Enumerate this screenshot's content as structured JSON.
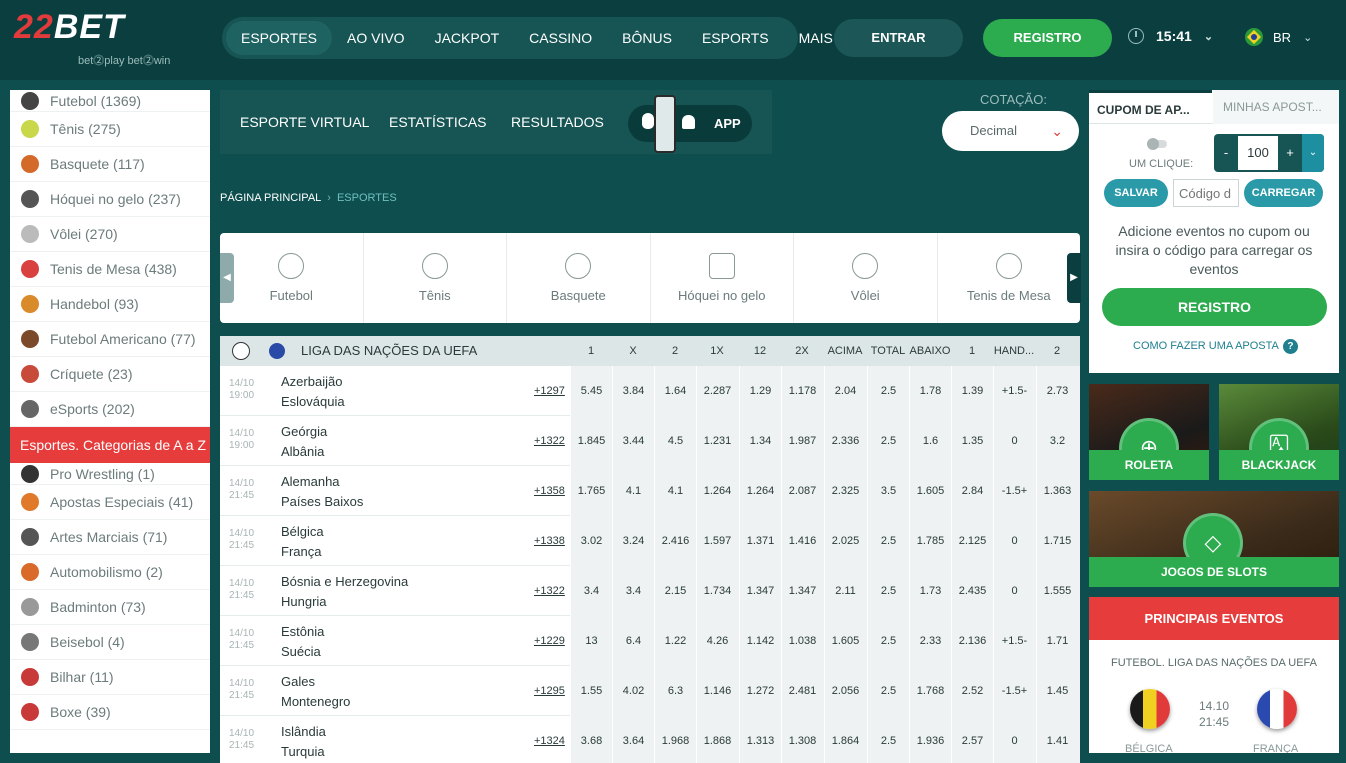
{
  "header": {
    "logo_text": "22BET",
    "logo_tagline": "bet⓶play  bet⓶win",
    "nav": [
      "ESPORTES",
      "AO VIVO",
      "JACKPOT",
      "CASSINO",
      "BÔNUS",
      "ESPORTS",
      "MAIS"
    ],
    "login": "ENTRAR",
    "register": "REGISTRO",
    "time": "15:41",
    "lang": "BR"
  },
  "sidebar": {
    "items_top": [
      {
        "label": "Futebol (1369)",
        "color": "#444444"
      },
      {
        "label": "Tênis (275)",
        "color": "#c8d84a"
      },
      {
        "label": "Basquete (117)",
        "color": "#d46a2a"
      },
      {
        "label": "Hóquei no gelo (237)",
        "color": "#555555"
      },
      {
        "label": "Vôlei (270)",
        "color": "#bbbbbb"
      },
      {
        "label": "Tenis de Mesa (438)",
        "color": "#d94040"
      },
      {
        "label": "Handebol (93)",
        "color": "#d98a2a"
      },
      {
        "label": "Futebol Americano (77)",
        "color": "#7a4a2a"
      },
      {
        "label": "Críquete (23)",
        "color": "#c84a3a"
      },
      {
        "label": "eSports (202)",
        "color": "#666666"
      }
    ],
    "category_header": "Esportes. Categorias de A a Z",
    "items_az": [
      {
        "label": "Pro Wrestling (1)",
        "color": "#333333"
      },
      {
        "label": "Apostas Especiais (41)",
        "color": "#e07a2a"
      },
      {
        "label": "Artes Marciais (71)",
        "color": "#555555"
      },
      {
        "label": "Automobilismo (2)",
        "color": "#d96a2a"
      },
      {
        "label": "Badminton (73)",
        "color": "#999999"
      },
      {
        "label": "Beisebol (4)",
        "color": "#777777"
      },
      {
        "label": "Bilhar (11)",
        "color": "#c83a3a"
      },
      {
        "label": "Boxe (39)",
        "color": "#c83a3a"
      }
    ]
  },
  "subnav": {
    "items": [
      "ESPORTE VIRTUAL",
      "ESTATÍSTICAS",
      "RESULTADOS"
    ],
    "app": "APP",
    "odds_label": "COTAÇÃO:",
    "odds_value": "Decimal"
  },
  "breadcrumb": {
    "home": "PÁGINA PRINCIPAL",
    "current": "ESPORTES"
  },
  "sports_bar": [
    "Futebol",
    "Tênis",
    "Basquete",
    "Hóquei no gelo",
    "Vôlei",
    "Tenis de Mesa"
  ],
  "table": {
    "league": "LIGA DAS NAÇÕES DA UEFA",
    "columns": [
      "1",
      "X",
      "2",
      "1X",
      "12",
      "2X",
      "ACIMA",
      "TOTAL",
      "ABAIXO",
      "1",
      "HAND...",
      "2"
    ],
    "rows": [
      {
        "date": "14/10",
        "time": "19:00",
        "home": "Azerbaijão",
        "away": "Eslováquia",
        "more": "+1297",
        "odds": [
          "5.45",
          "3.84",
          "1.64",
          "2.287",
          "1.29",
          "1.178",
          "2.04",
          "2.5",
          "1.78",
          "1.39",
          "+1.5-",
          "2.73"
        ]
      },
      {
        "date": "14/10",
        "time": "19:00",
        "home": "Geórgia",
        "away": "Albânia",
        "more": "+1322",
        "odds": [
          "1.845",
          "3.44",
          "4.5",
          "1.231",
          "1.34",
          "1.987",
          "2.336",
          "2.5",
          "1.6",
          "1.35",
          "0",
          "3.2"
        ]
      },
      {
        "date": "14/10",
        "time": "21:45",
        "home": "Alemanha",
        "away": "Países Baixos",
        "more": "+1358",
        "odds": [
          "1.765",
          "4.1",
          "4.1",
          "1.264",
          "1.264",
          "2.087",
          "2.325",
          "3.5",
          "1.605",
          "2.84",
          "-1.5+",
          "1.363"
        ]
      },
      {
        "date": "14/10",
        "time": "21:45",
        "home": "Bélgica",
        "away": "França",
        "more": "+1338",
        "odds": [
          "3.02",
          "3.24",
          "2.416",
          "1.597",
          "1.371",
          "1.416",
          "2.025",
          "2.5",
          "1.785",
          "2.125",
          "0",
          "1.715"
        ]
      },
      {
        "date": "14/10",
        "time": "21:45",
        "home": "Bósnia e Herzegovina",
        "away": "Hungria",
        "more": "+1322",
        "odds": [
          "3.4",
          "3.4",
          "2.15",
          "1.734",
          "1.347",
          "1.347",
          "2.11",
          "2.5",
          "1.73",
          "2.435",
          "0",
          "1.555"
        ]
      },
      {
        "date": "14/10",
        "time": "21:45",
        "home": "Estônia",
        "away": "Suécia",
        "more": "+1229",
        "odds": [
          "13",
          "6.4",
          "1.22",
          "4.26",
          "1.142",
          "1.038",
          "1.605",
          "2.5",
          "2.33",
          "2.136",
          "+1.5-",
          "1.71"
        ]
      },
      {
        "date": "14/10",
        "time": "21:45",
        "home": "Gales",
        "away": "Montenegro",
        "more": "+1295",
        "odds": [
          "1.55",
          "4.02",
          "6.3",
          "1.146",
          "1.272",
          "2.481",
          "2.056",
          "2.5",
          "1.768",
          "2.52",
          "-1.5+",
          "1.45"
        ]
      },
      {
        "date": "14/10",
        "time": "21:45",
        "home": "Islândia",
        "away": "Turquia",
        "more": "+1324",
        "odds": [
          "3.68",
          "3.64",
          "1.968",
          "1.868",
          "1.313",
          "1.308",
          "1.864",
          "2.5",
          "1.936",
          "2.57",
          "0",
          "1.41"
        ]
      }
    ]
  },
  "coupon": {
    "tab1": "CUPOM DE AP...",
    "tab2": "MINHAS APOST...",
    "one_click": "UM CLIQUE:",
    "stake": "100",
    "minus": "-",
    "plus": "+",
    "save": "SALVAR",
    "code_placeholder": "Código d",
    "load": "CARREGAR",
    "info": "Adicione eventos no cupom ou insira o código para carregar os eventos",
    "register": "REGISTRO",
    "how_to": "COMO FAZER UMA APOSTA"
  },
  "games": {
    "roulette": "ROLETA",
    "blackjack": "BLACKJACK",
    "slots": "JOGOS DE SLOTS"
  },
  "top_events": {
    "title": "PRINCIPAIS EVENTOS",
    "league": "FUTEBOL. LIGA DAS NAÇÕES DA UEFA",
    "date": "14.10",
    "time": "21:45",
    "home": "BÉLGICA",
    "away": "FRANÇA"
  }
}
